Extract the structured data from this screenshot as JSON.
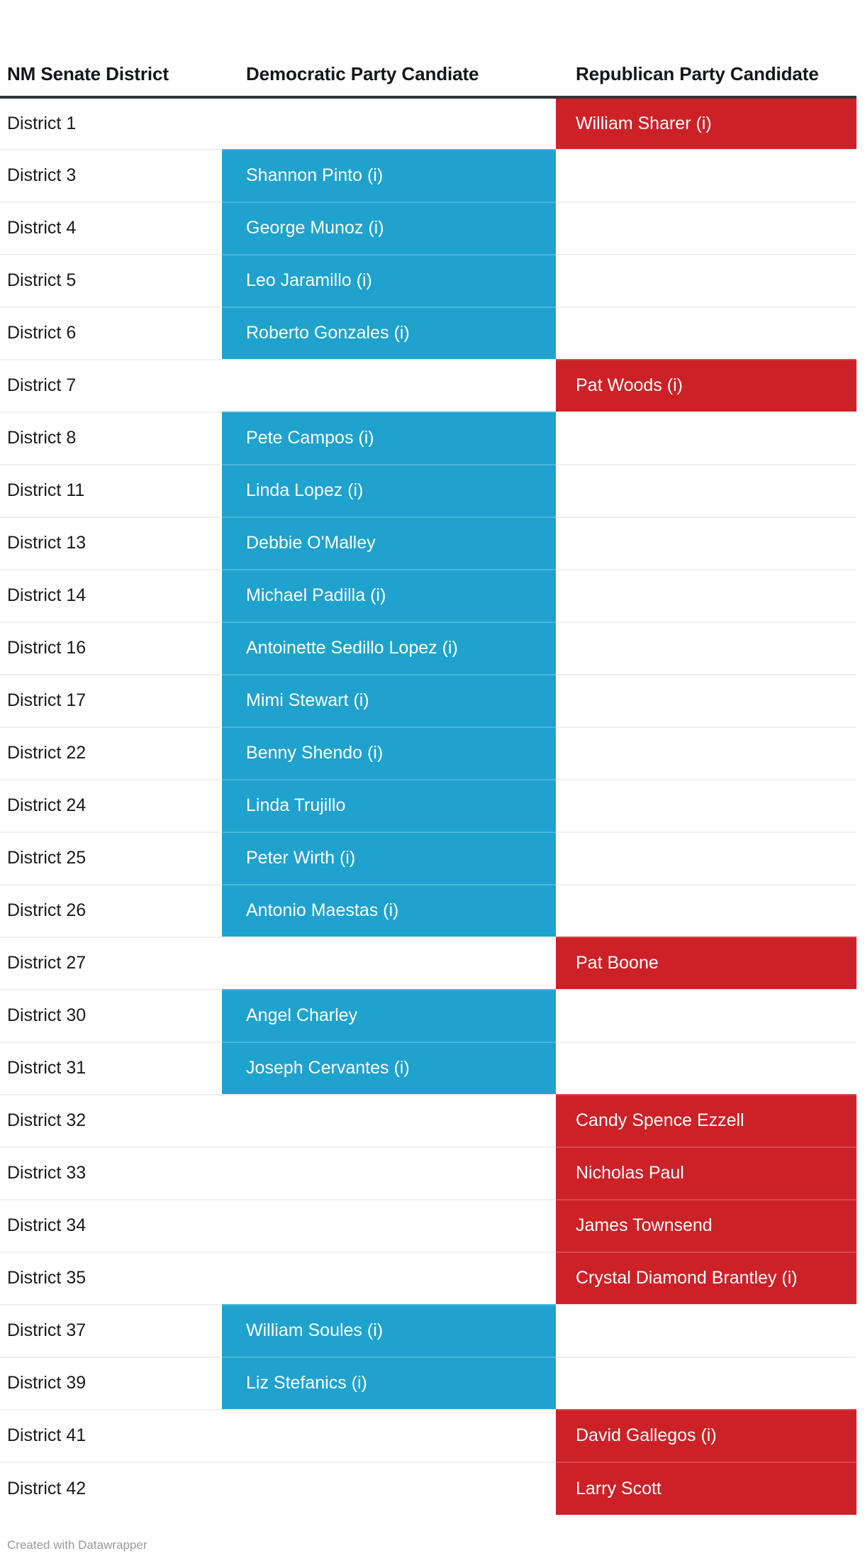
{
  "table": {
    "columns": [
      {
        "key": "district",
        "label": "NM Senate District"
      },
      {
        "key": "democrat",
        "label": "Democratic Party Candiate"
      },
      {
        "key": "republican",
        "label": "Republican Party Candidate"
      }
    ],
    "rows": [
      {
        "district": "District 1",
        "democrat": "",
        "republican": "William Sharer (i)"
      },
      {
        "district": "District 3",
        "democrat": "Shannon Pinto (i)",
        "republican": ""
      },
      {
        "district": "District 4",
        "democrat": "George Munoz (i)",
        "republican": ""
      },
      {
        "district": "District 5",
        "democrat": "Leo Jaramillo (i)",
        "republican": ""
      },
      {
        "district": "District 6",
        "democrat": "Roberto Gonzales (i)",
        "republican": ""
      },
      {
        "district": "District 7",
        "democrat": "",
        "republican": "Pat Woods (i)"
      },
      {
        "district": "District 8",
        "democrat": "Pete Campos (i)",
        "republican": ""
      },
      {
        "district": "District 11",
        "democrat": "Linda Lopez (i)",
        "republican": ""
      },
      {
        "district": "District 13",
        "democrat": "Debbie O'Malley",
        "republican": ""
      },
      {
        "district": "District 14",
        "democrat": "Michael Padilla (i)",
        "republican": ""
      },
      {
        "district": "District 16",
        "democrat": "Antoinette Sedillo Lopez (i)",
        "republican": ""
      },
      {
        "district": "District 17",
        "democrat": "Mimi Stewart (i)",
        "republican": ""
      },
      {
        "district": "District 22",
        "democrat": "Benny Shendo (i)",
        "republican": ""
      },
      {
        "district": "District 24",
        "democrat": "Linda Trujillo",
        "republican": ""
      },
      {
        "district": "District 25",
        "democrat": "Peter Wirth (i)",
        "republican": ""
      },
      {
        "district": "District 26",
        "democrat": "Antonio Maestas (i)",
        "republican": ""
      },
      {
        "district": "District 27",
        "democrat": "",
        "republican": "Pat Boone"
      },
      {
        "district": "District 30",
        "democrat": "Angel Charley",
        "republican": ""
      },
      {
        "district": "District 31",
        "democrat": "Joseph Cervantes (i)",
        "republican": ""
      },
      {
        "district": "District 32",
        "democrat": "",
        "republican": "Candy Spence Ezzell"
      },
      {
        "district": "District 33",
        "democrat": "",
        "republican": "Nicholas Paul"
      },
      {
        "district": "District 34",
        "democrat": "",
        "republican": "James Townsend"
      },
      {
        "district": "District 35",
        "democrat": "",
        "republican": "Crystal Diamond Brantley (i)"
      },
      {
        "district": "District 37",
        "democrat": "William Soules (i)",
        "republican": ""
      },
      {
        "district": "District 39",
        "democrat": "Liz Stefanics (i)",
        "republican": ""
      },
      {
        "district": "District 41",
        "democrat": "",
        "republican": "David Gallegos (i)"
      },
      {
        "district": "District 42",
        "democrat": "",
        "republican": "Larry Scott"
      }
    ]
  },
  "footer": {
    "credit": "Created with Datawrapper"
  },
  "colors": {
    "democrat_fill": "#1fa2ce",
    "republican_fill": "#cc2127",
    "header_rule": "#333638",
    "row_divider": "#f0f0f0",
    "text": "#1a1a1a",
    "cell_text_on_fill": "#ffffff",
    "footer_text": "#999999",
    "background": "#ffffff"
  }
}
